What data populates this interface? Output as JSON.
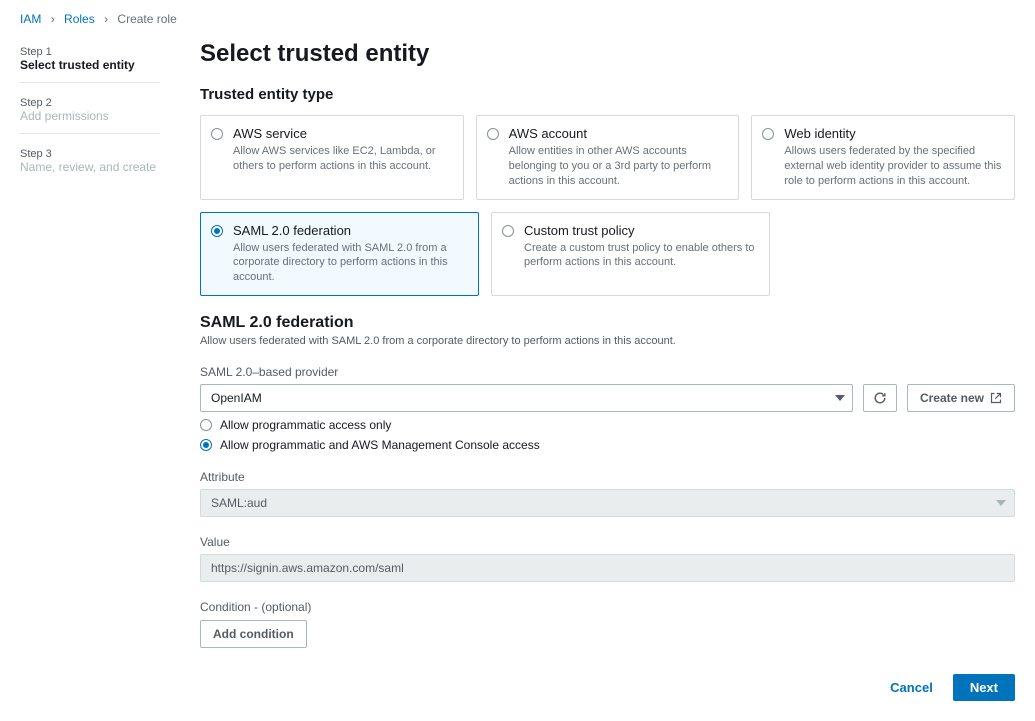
{
  "breadcrumb": {
    "iam": "IAM",
    "roles": "Roles",
    "current": "Create role"
  },
  "steps": [
    {
      "label": "Step 1",
      "title": "Select trusted entity"
    },
    {
      "label": "Step 2",
      "title": "Add permissions"
    },
    {
      "label": "Step 3",
      "title": "Name, review, and create"
    }
  ],
  "heading": "Select trusted entity",
  "trusted_entity_type_heading": "Trusted entity type",
  "cards": {
    "aws_service": {
      "title": "AWS service",
      "desc": "Allow AWS services like EC2, Lambda, or others to perform actions in this account."
    },
    "aws_account": {
      "title": "AWS account",
      "desc": "Allow entities in other AWS accounts belonging to you or a 3rd party to perform actions in this account."
    },
    "web_identity": {
      "title": "Web identity",
      "desc": "Allows users federated by the specified external web identity provider to assume this role to perform actions in this account."
    },
    "saml": {
      "title": "SAML 2.0 federation",
      "desc": "Allow users federated with SAML 2.0 from a corporate directory to perform actions in this account."
    },
    "custom": {
      "title": "Custom trust policy",
      "desc": "Create a custom trust policy to enable others to perform actions in this account."
    }
  },
  "saml_section": {
    "heading": "SAML 2.0 federation",
    "desc": "Allow users federated with SAML 2.0 from a corporate directory to perform actions in this account.",
    "provider_label": "SAML 2.0–based provider",
    "provider_value": "OpenIAM",
    "create_new": "Create new",
    "access_programmatic": "Allow programmatic access only",
    "access_both": "Allow programmatic and AWS Management Console access",
    "attribute_label": "Attribute",
    "attribute_value": "SAML:aud",
    "value_label": "Value",
    "value_value": "https://signin.aws.amazon.com/saml",
    "condition_label": "Condition - (optional)",
    "add_condition": "Add condition"
  },
  "footer": {
    "cancel": "Cancel",
    "next": "Next"
  }
}
